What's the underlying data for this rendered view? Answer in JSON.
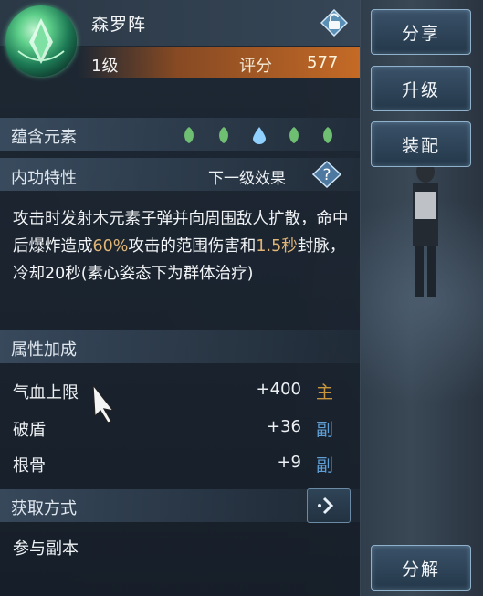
{
  "item": {
    "name": "森罗阵",
    "level": "1级",
    "score_label": "评分",
    "score_value": "577"
  },
  "elements": {
    "label": "蕴含元素",
    "icons": [
      "wood-element-icon",
      "wood-element-icon",
      "water-element-icon",
      "wood-element-icon",
      "wood-element-icon"
    ]
  },
  "skill": {
    "label": "内功特性",
    "next_level": "下一级效果",
    "desc": [
      {
        "t": "攻击时发射木元素子弹并向周围敌人扩散，命中后爆炸造成",
        "hl": false
      },
      {
        "t": "60%",
        "hl": true
      },
      {
        "t": "攻击的范围伤害和",
        "hl": false
      },
      {
        "t": "1.5秒",
        "hl": true
      },
      {
        "t": "封脉，冷却20秒(素心姿态下为群体治疗)",
        "hl": false
      }
    ]
  },
  "attributes": {
    "label": "属性加成",
    "rows": [
      {
        "name": "气血上限",
        "value": "+400",
        "tag": "主"
      },
      {
        "name": "破盾",
        "value": "+36",
        "tag": "副"
      },
      {
        "name": "根骨",
        "value": "+9",
        "tag": "副"
      }
    ]
  },
  "source": {
    "label": "获取方式",
    "value": "参与副本"
  },
  "buttons": {
    "share": "分享",
    "upgrade": "升级",
    "equip": "装配",
    "decompose": "分解"
  },
  "colors": {
    "highlight": "#e0b577",
    "main_tag": "#c9963d",
    "sub_tag": "#5f9fd6",
    "level_bar": "#c46a26",
    "element_green": "#6fbf73",
    "element_blue": "#8fd0ff"
  }
}
